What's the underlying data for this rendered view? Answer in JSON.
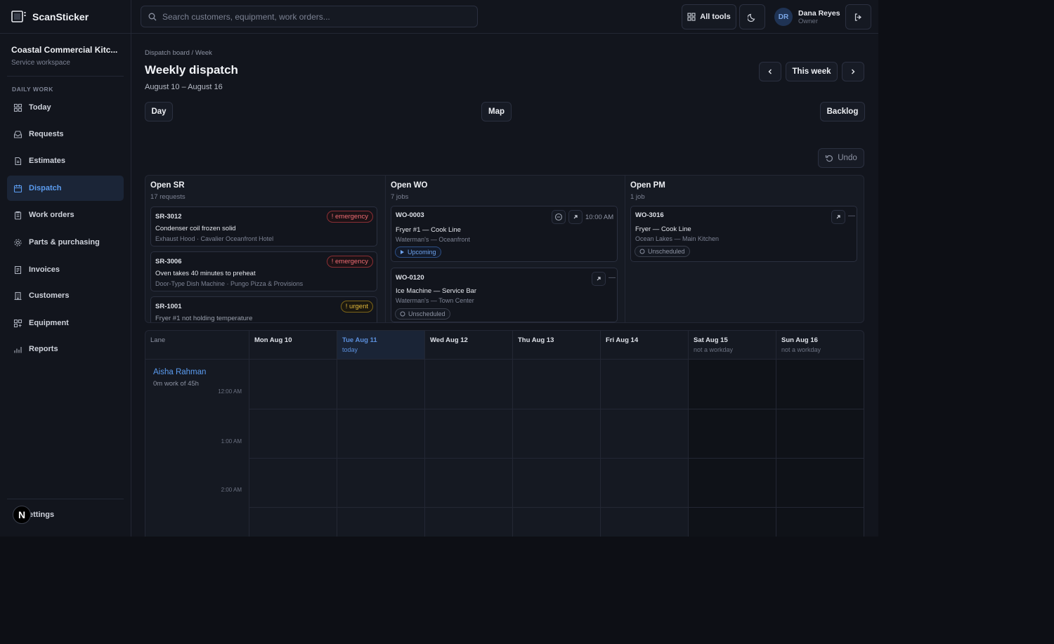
{
  "app": {
    "name": "ScanSticker"
  },
  "search": {
    "placeholder": "Search customers, equipment, work orders..."
  },
  "topbar": {
    "all_tools": "All tools",
    "user_initials": "DR",
    "user_name": "Dana Reyes",
    "user_role": "Owner"
  },
  "workspace": {
    "name": "Coastal Commercial Kitc...",
    "subtitle": "Service workspace"
  },
  "sidebar": {
    "section": "DAILY WORK",
    "items": [
      {
        "label": "Today",
        "icon": "grid-icon"
      },
      {
        "label": "Requests",
        "icon": "inbox-icon"
      },
      {
        "label": "Estimates",
        "icon": "estimate-icon"
      },
      {
        "label": "Dispatch",
        "icon": "calendar-icon",
        "active": true
      },
      {
        "label": "Work orders",
        "icon": "clipboard-icon"
      },
      {
        "label": "Parts & purchasing",
        "icon": "gear-icon"
      },
      {
        "label": "Invoices",
        "icon": "invoice-icon"
      },
      {
        "label": "Customers",
        "icon": "building-icon"
      },
      {
        "label": "Equipment",
        "icon": "equipment-icon"
      },
      {
        "label": "Reports",
        "icon": "chart-icon"
      }
    ],
    "settings_badge": "N",
    "settings_label": "ettings"
  },
  "page": {
    "breadcrumb": "Dispatch board / Week",
    "title": "Weekly dispatch",
    "date_range": "August 10 – August 16",
    "this_week": "This week",
    "day": "Day",
    "map": "Map",
    "backlog": "Backlog",
    "undo": "Undo"
  },
  "board": {
    "open_sr": {
      "title": "Open SR",
      "count": "17 requests",
      "cards": [
        {
          "id": "SR-3012",
          "tag": "! emergency",
          "title": "Condenser coil frozen solid",
          "sub": "Exhaust Hood · Cavalier Oceanfront Hotel"
        },
        {
          "id": "SR-3006",
          "tag": "! emergency",
          "title": "Oven takes 40 minutes to preheat",
          "sub": "Door-Type Dish Machine · Pungo Pizza & Provisions"
        },
        {
          "id": "SR-1001",
          "tag": "! urgent",
          "title": "Fryer #1 not holding temperature",
          "sub": ""
        }
      ]
    },
    "open_wo": {
      "title": "Open WO",
      "count": "7 jobs",
      "cards": [
        {
          "id": "WO-0003",
          "time": "10:00 AM",
          "title": "Fryer #1 — Cook Line",
          "sub": "Waterman's — Oceanfront",
          "status": "Upcoming"
        },
        {
          "id": "WO-0120",
          "title": "Ice Machine — Service Bar",
          "sub": "Waterman's — Town Center",
          "status": "Unscheduled",
          "dash": "—"
        }
      ]
    },
    "open_pm": {
      "title": "Open PM",
      "count": "1 job",
      "cards": [
        {
          "id": "WO-3016",
          "title": "Fryer — Cook Line",
          "sub": "Ocean Lakes — Main Kitchen",
          "status": "Unscheduled",
          "dash": "—"
        }
      ]
    }
  },
  "calendar": {
    "lane_header": "Lane",
    "days": [
      {
        "label": "Mon Aug 10",
        "sub": ""
      },
      {
        "label": "Tue Aug 11",
        "sub": "today"
      },
      {
        "label": "Wed Aug 12",
        "sub": ""
      },
      {
        "label": "Thu Aug 13",
        "sub": ""
      },
      {
        "label": "Fri Aug 14",
        "sub": ""
      },
      {
        "label": "Sat Aug 15",
        "sub": "not a workday"
      },
      {
        "label": "Sun Aug 16",
        "sub": "not a workday"
      }
    ],
    "lane": {
      "name": "Aisha Rahman",
      "sub": "0m work of 45h"
    },
    "hours": [
      "12:00 AM",
      "1:00 AM",
      "2:00 AM"
    ]
  },
  "colors": {
    "accent": "#5b9cf0",
    "emergency": "#ef6b72",
    "urgent": "#e2b83a",
    "background": "#12151d"
  }
}
